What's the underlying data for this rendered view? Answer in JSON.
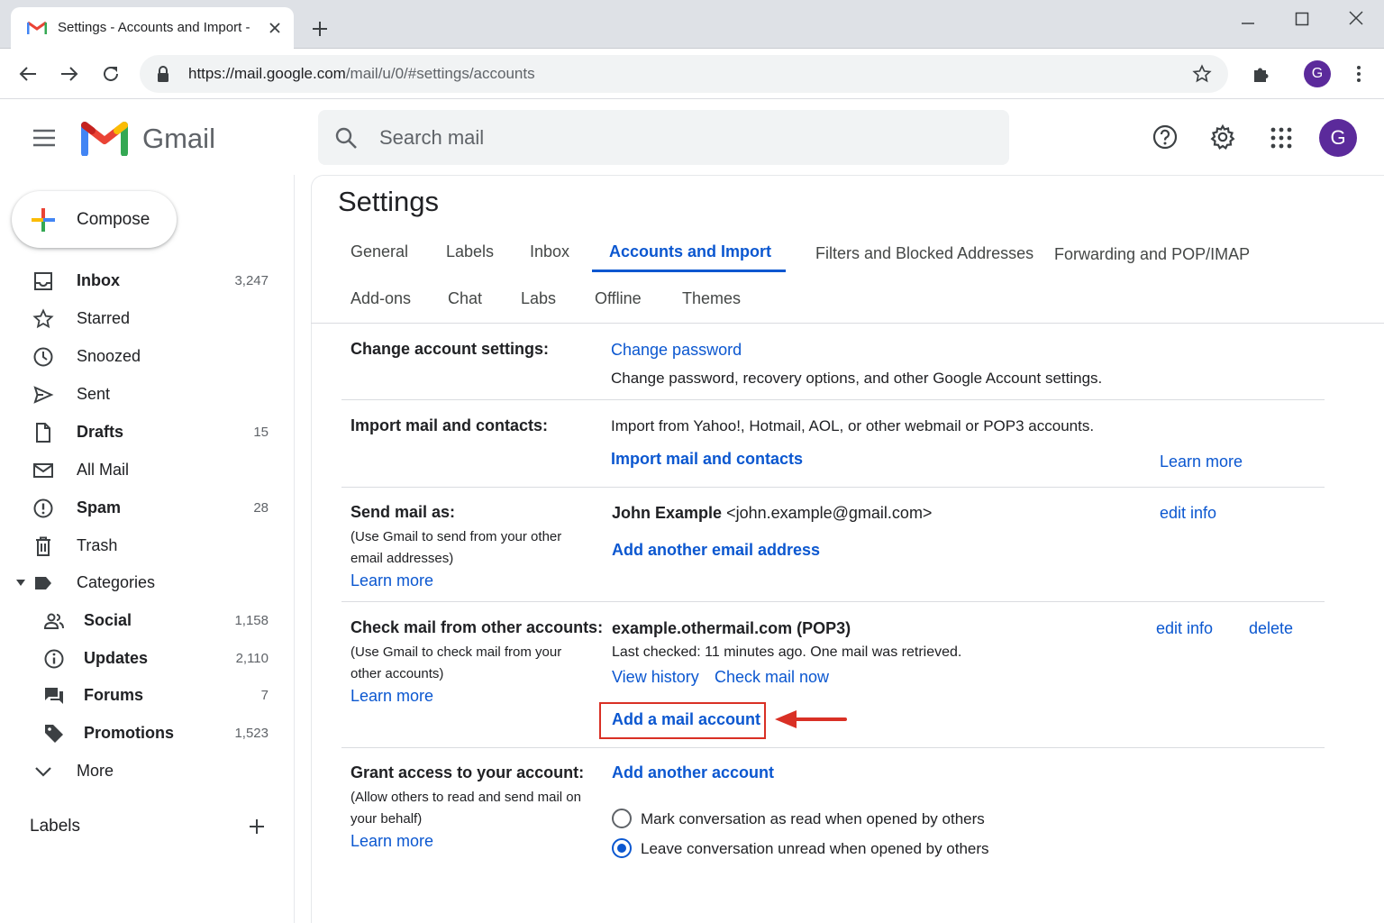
{
  "browser": {
    "tab_title": "Settings - Accounts and Import -",
    "url_host": "https://mail.google.com",
    "url_path": "/mail/u/0/#settings/accounts",
    "profile_initial": "G"
  },
  "header": {
    "app_name": "Gmail",
    "search_placeholder": "Search mail",
    "avatar_initial": "G"
  },
  "sidebar": {
    "compose_label": "Compose",
    "items": [
      {
        "label": "Inbox",
        "count": "3,247",
        "bold": true,
        "icon": "inbox-icon"
      },
      {
        "label": "Starred",
        "count": "",
        "bold": false,
        "icon": "star-icon"
      },
      {
        "label": "Snoozed",
        "count": "",
        "bold": false,
        "icon": "clock-icon"
      },
      {
        "label": "Sent",
        "count": "",
        "bold": false,
        "icon": "send-icon"
      },
      {
        "label": "Drafts",
        "count": "15",
        "bold": true,
        "icon": "draft-icon"
      },
      {
        "label": "All Mail",
        "count": "",
        "bold": false,
        "icon": "mail-icon"
      },
      {
        "label": "Spam",
        "count": "28",
        "bold": true,
        "icon": "spam-icon"
      },
      {
        "label": "Trash",
        "count": "",
        "bold": false,
        "icon": "trash-icon"
      },
      {
        "label": "Categories",
        "count": "",
        "bold": false,
        "icon": "label-icon"
      },
      {
        "label": "Social",
        "count": "1,158",
        "bold": true,
        "icon": "people-icon"
      },
      {
        "label": "Updates",
        "count": "2,110",
        "bold": true,
        "icon": "info-icon"
      },
      {
        "label": "Forums",
        "count": "7",
        "bold": true,
        "icon": "forum-icon"
      },
      {
        "label": "Promotions",
        "count": "1,523",
        "bold": true,
        "icon": "tag-icon"
      },
      {
        "label": "More",
        "count": "",
        "bold": false,
        "icon": "chevron-down-icon"
      }
    ],
    "labels_heading": "Labels"
  },
  "settings": {
    "title": "Settings",
    "tabs_row1": [
      "General",
      "Labels",
      "Inbox",
      "Accounts and Import",
      "Filters and Blocked Addresses",
      "Forwarding and POP/IMAP"
    ],
    "tabs_row2": [
      "Add-ons",
      "Chat",
      "Labs",
      "Offline",
      "Themes"
    ],
    "change_account": {
      "title": "Change account settings:",
      "link": "Change password",
      "desc": "Change password, recovery options, and other Google Account settings."
    },
    "import": {
      "title": "Import mail and contacts:",
      "desc": "Import from Yahoo!, Hotmail, AOL, or other webmail or POP3 accounts.",
      "link": "Import mail and contacts",
      "learn_more": "Learn more"
    },
    "send_as": {
      "title": "Send mail as:",
      "note": "(Use Gmail to send from your other email addresses)",
      "learn_more": "Learn more",
      "name": "John Example",
      "email": "<john.example@gmail.com>",
      "edit_info": "edit info",
      "add_link": "Add another email address"
    },
    "check_mail": {
      "title": "Check mail from other accounts:",
      "note": "(Use Gmail to check mail from your other accounts)",
      "learn_more": "Learn more",
      "account": "example.othermail.com (POP3)",
      "last_checked": "Last checked: 11 minutes ago. One mail was retrieved.",
      "view_history": "View history",
      "check_now": "Check mail now",
      "edit_info": "edit info",
      "delete": "delete",
      "add_link": "Add a mail account"
    },
    "grant": {
      "title": "Grant access to your account:",
      "note": "(Allow others to read and send mail on your behalf)",
      "learn_more": "Learn more",
      "add_link": "Add another account",
      "option_read": "Mark conversation as read when opened by others",
      "option_unread": "Leave conversation unread when opened by others",
      "selected": "unread"
    }
  },
  "colors": {
    "accent": "#0b57d0",
    "annotation": "#d93025",
    "avatar": "#5b2a9b"
  }
}
